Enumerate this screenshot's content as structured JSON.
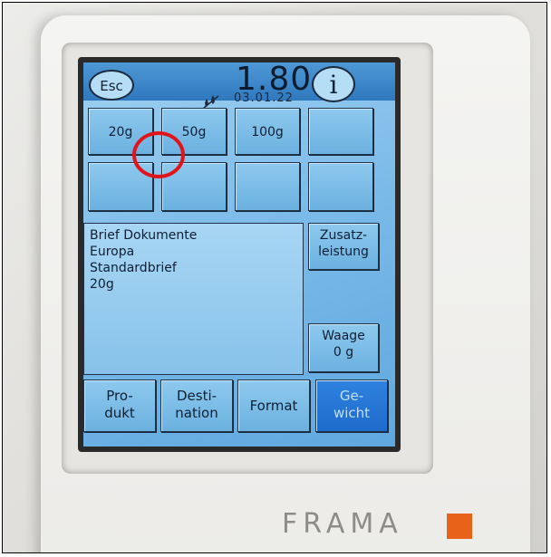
{
  "header": {
    "esc_label": "Esc",
    "price": "1.80",
    "info_label": "i",
    "date": "03.01.22",
    "ink_icon": "ink-drops-icon"
  },
  "weight_presets": [
    {
      "label": "20g",
      "selected": true
    },
    {
      "label": "50g"
    },
    {
      "label": "100g"
    },
    {
      "label": ""
    }
  ],
  "empty_slots": [
    "",
    "",
    "",
    ""
  ],
  "product_summary": {
    "lines": [
      "Brief Dokumente",
      "Europa",
      "Standardbrief",
      "20g"
    ]
  },
  "side_buttons": {
    "zusatz": [
      "Zusatz-",
      "leistung"
    ],
    "waage": [
      "Waage",
      "0 g"
    ]
  },
  "tabs": [
    {
      "lines": [
        "Pro-",
        "dukt"
      ]
    },
    {
      "lines": [
        "Desti-",
        "nation"
      ]
    },
    {
      "lines": [
        "Format"
      ]
    },
    {
      "lines": [
        "Ge-",
        "wicht"
      ],
      "active": true
    }
  ],
  "brand": {
    "name": "FRAMA",
    "accent_color": "#e8621a",
    "highlight_color": "#e1141b"
  }
}
